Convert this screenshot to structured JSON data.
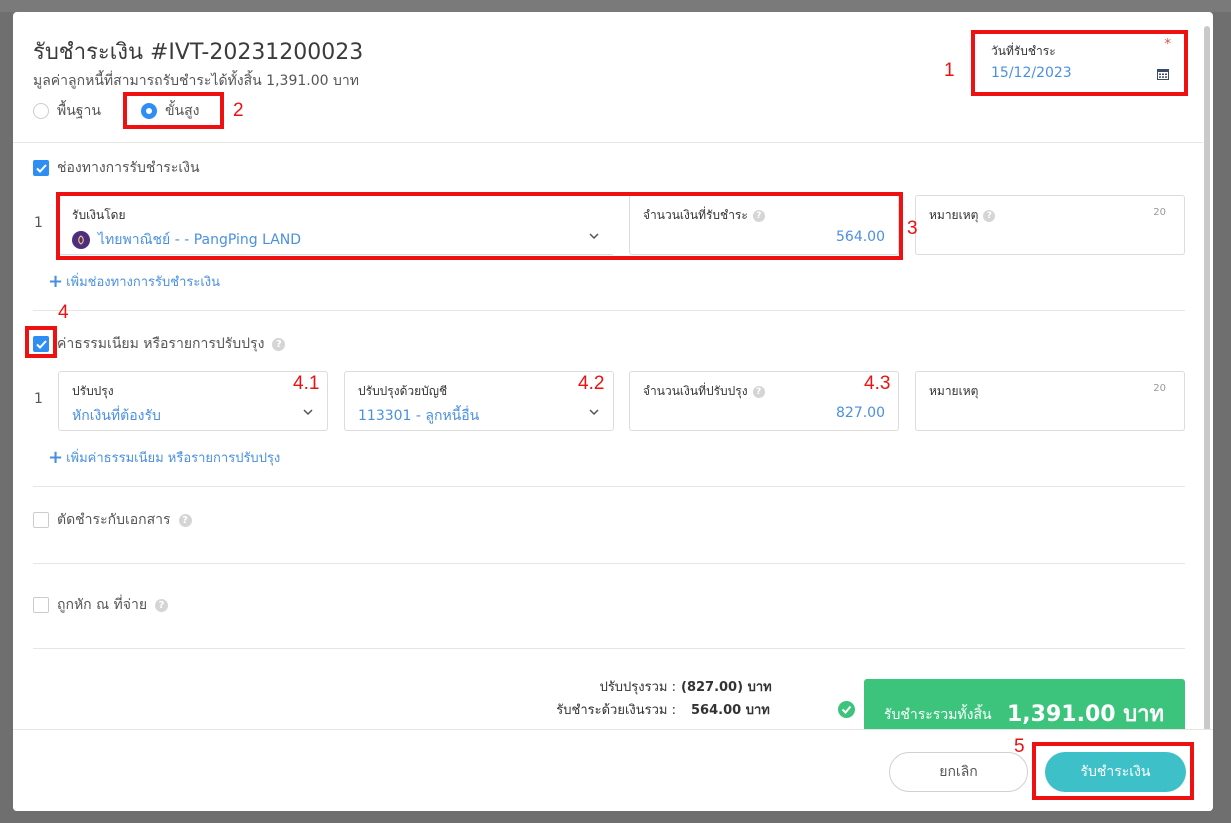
{
  "modal": {
    "title": "รับชำระเงิน #IVT-20231200023",
    "subtitle": "มูลค่าลูกหนี้ที่สามารถรับชำระได้ทั้งสิ้น 1,391.00 บาท",
    "mode_options": [
      {
        "label": "พื้นฐาน",
        "selected": false
      },
      {
        "label": "ขั้นสูง",
        "selected": true
      }
    ],
    "date_field": {
      "label": "วันที่รับชำระ",
      "required_mark": "*",
      "value": "15/12/2023",
      "icon": "calendar-icon"
    }
  },
  "payment_section": {
    "checkbox_label": "ช่องทางการรับชำระเงิน",
    "checked": true,
    "rows": [
      {
        "index": "1",
        "method_label": "รับเงินโดย",
        "method_value": "ไทยพาณิชย์ - - PangPing LAND",
        "amount_label": "จำนวนเงินที่รับชำระ",
        "amount_value": "564.00",
        "note_label": "หมายเหตุ",
        "note_counter": "20"
      }
    ],
    "add_link": "เพิ่มช่องทางการรับชำระเงิน"
  },
  "adjustment_section": {
    "checkbox_label": "ค่าธรรมเนียม หรือรายการปรับปรุง",
    "checked": true,
    "rows": [
      {
        "index": "1",
        "adjust_label": "ปรับปรุง",
        "adjust_value": "หักเงินที่ต้องรับ",
        "account_label": "ปรับปรุงด้วยบัญชี",
        "account_value": "113301 - ลูกหนี้อื่น",
        "amount_label": "จำนวนเงินที่ปรับปรุง",
        "amount_value": "827.00",
        "note_label": "หมายเหตุ",
        "note_counter": "20"
      }
    ],
    "add_link": "เพิ่มค่าธรรมเนียม หรือรายการปรับปรุง"
  },
  "offset_section": {
    "checkbox_label": "ตัดชำระกับเอกสาร",
    "checked": false
  },
  "withholding_section": {
    "checkbox_label": "ถูกหัก ณ ที่จ่าย",
    "checked": false
  },
  "summary": {
    "adjust_total_label": "ปรับปรุงรวม :",
    "adjust_total_value": "(827.00) บาท",
    "cash_total_label": "รับชำระด้วยเงินรวม :",
    "cash_total_value": "564.00 บาท",
    "grand_total_label": "รับชำระรวมทั้งสิ้น",
    "grand_total_value": "1,391.00 บาท"
  },
  "footer": {
    "cancel_label": "ยกเลิก",
    "submit_label": "รับชำระเงิน"
  },
  "annotations": [
    "1",
    "2",
    "3",
    "4",
    "4.1",
    "4.2",
    "4.3",
    "5"
  ],
  "colors": {
    "accent": "#2f8ef4",
    "value_text": "#4a90e2",
    "total_green": "#3cc47c",
    "submit_teal": "#3ec0c9",
    "highlight_red": "#ee1111"
  }
}
